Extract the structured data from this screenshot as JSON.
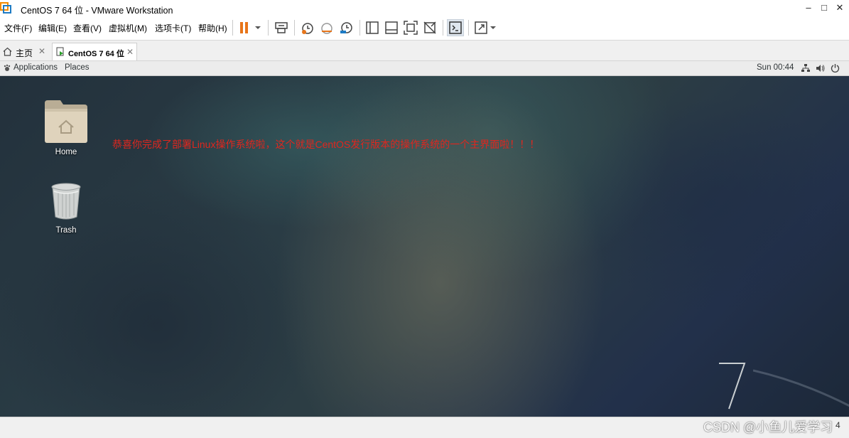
{
  "window": {
    "title": "CentOS 7 64 位 - VMware Workstation",
    "minimize_glyph": "–",
    "maximize_glyph": "□",
    "close_glyph": "✕"
  },
  "menu": [
    "文件(F)",
    "编辑(E)",
    "查看(V)",
    "虚拟机(M)",
    "选项卡(T)",
    "帮助(H)"
  ],
  "tabs": [
    {
      "label": "主页",
      "icon": "home-icon",
      "active": false
    },
    {
      "label": "CentOS 7 64 位",
      "icon": "vm-icon",
      "active": true
    }
  ],
  "tab_close_glyph": "✕",
  "gnome_panel": {
    "applications": "Applications",
    "places": "Places",
    "clock": "Sun 00:44"
  },
  "desktop": {
    "icons": [
      {
        "label": "Home",
        "icon": "home-folder-icon"
      },
      {
        "label": "Trash",
        "icon": "trash-icon"
      }
    ],
    "annotation": "恭喜你完成了部署Linux操作系统啦，这个就是CentOS发行版本的操作系统的一个主界面啦！！！"
  },
  "watermark": "CSDN @小鱼儿爱学习",
  "status_right": "4",
  "colors": {
    "annotation": "#e0261e",
    "pause_orange": "#e8751a",
    "vmware_orange": "#f38b00"
  }
}
